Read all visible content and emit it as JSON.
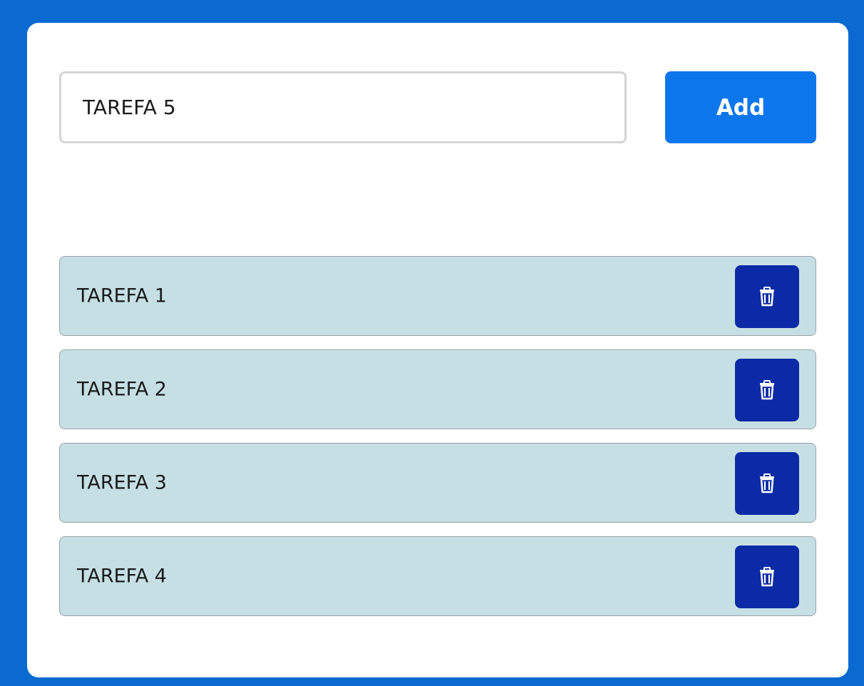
{
  "input": {
    "value": "TAREFA 5"
  },
  "add_button": {
    "label": "Add"
  },
  "tasks": [
    {
      "label": "TAREFA 1",
      "delete_icon": "trash-icon"
    },
    {
      "label": "TAREFA 2",
      "delete_icon": "trash-icon"
    },
    {
      "label": "TAREFA 3",
      "delete_icon": "trash-icon"
    },
    {
      "label": "TAREFA 4",
      "delete_icon": "trash-icon"
    }
  ],
  "colors": {
    "background": "#0a6ad0",
    "add_button": "#0c76ec",
    "task_item": "#c6dfe4",
    "delete_button": "#0b2ba6"
  }
}
